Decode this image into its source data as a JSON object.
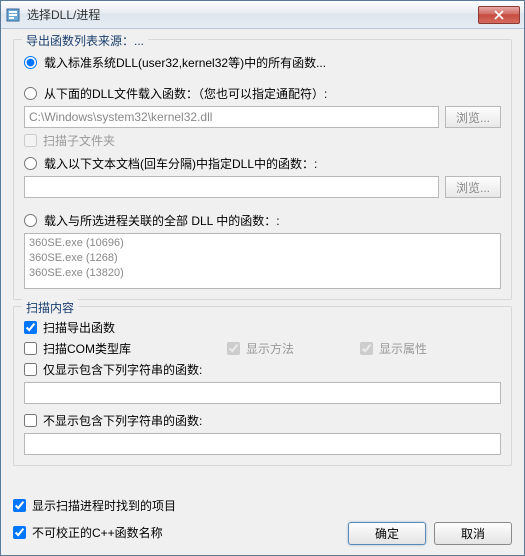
{
  "title": "选择DLL/进程",
  "group_source": {
    "legend": "导出函数列表来源：...",
    "opt_system": "载入标准系统DLL(user32,kernel32等)中的所有函数...",
    "opt_file": "从下面的DLL文件载入函数：（您也可以指定通配符）:",
    "file_path": "C:\\Windows\\system32\\kernel32.dll",
    "browse": "浏览...",
    "scan_subfolders": "扫描子文件夹",
    "opt_text": "载入以下文本文档(回车分隔)中指定DLL中的函数：:",
    "text_path": "",
    "opt_process": "载入与所选进程关联的全部 DLL 中的函数：:",
    "process_items": [
      "360SE.exe  (10696)",
      "360SE.exe  (1268)",
      "360SE.exe  (13820)"
    ]
  },
  "group_scan": {
    "legend": "扫描内容",
    "scan_exports": "扫描导出函数",
    "scan_com": "扫描COM类型库",
    "show_methods": "显示方法",
    "show_props": "显示属性",
    "only_contains": "仅显示包含下列字符串的函数:",
    "not_contains": "不显示包含下列字符串的函数:"
  },
  "bottom": {
    "show_while_scan": "显示扫描进程时找到的项目",
    "uncorrectable_cpp": "不可校正的C++函数名称"
  },
  "buttons": {
    "ok": "确定",
    "cancel": "取消"
  }
}
